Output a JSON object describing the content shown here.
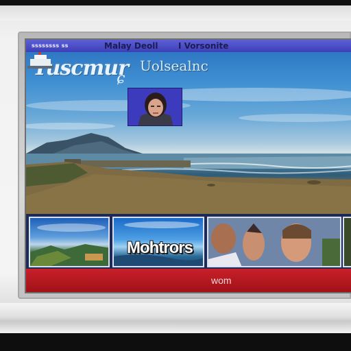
{
  "menu": {
    "item_1": "ssssssss ss",
    "item_2": "Malay Deoll",
    "item_3": "I Vorsonite"
  },
  "hero": {
    "logo_text": "Tuscmur",
    "logo_mark": "ɕ",
    "tagline": "Uolsealnc"
  },
  "thumbnails": {
    "featured_title": "Mohtrors"
  },
  "footer": {
    "label": "wom"
  },
  "colors": {
    "menu_bar": "#4a4dc8",
    "footer_bar": "#b8161f",
    "thumb_border": "#d8e0f2"
  }
}
